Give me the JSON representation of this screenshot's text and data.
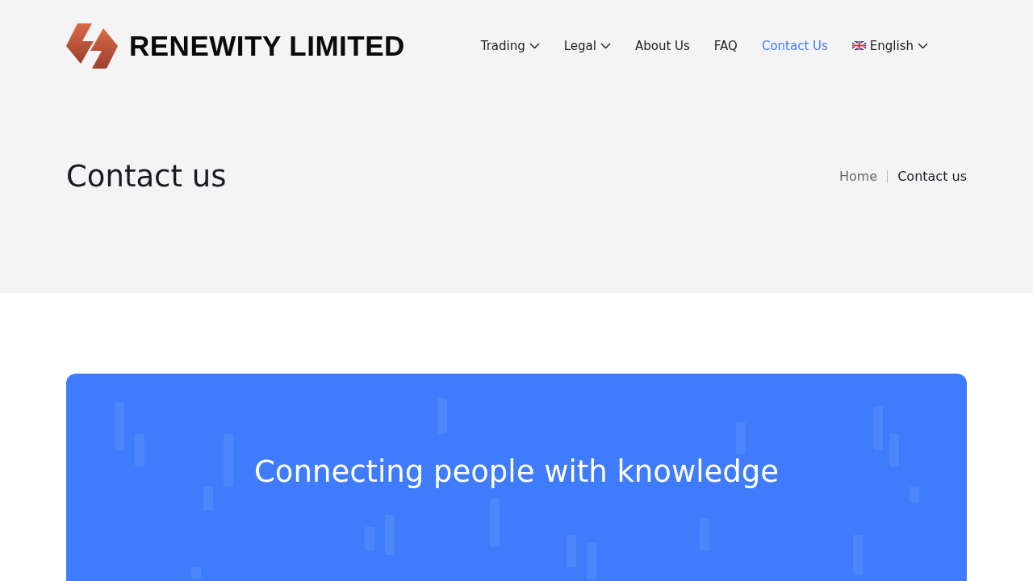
{
  "header": {
    "brand": "RENEWITY LIMITED",
    "nav": [
      {
        "label": "Trading",
        "kind": "dropdown",
        "selected": false
      },
      {
        "label": "Legal",
        "kind": "dropdown",
        "selected": false
      },
      {
        "label": "About Us",
        "kind": "link",
        "selected": false
      },
      {
        "label": "FAQ",
        "kind": "link",
        "selected": false
      },
      {
        "label": "Contact Us",
        "kind": "link",
        "selected": true
      },
      {
        "label": "English",
        "kind": "language",
        "selected": false
      }
    ]
  },
  "hero": {
    "title": "Contact us",
    "breadcrumb": [
      {
        "label": "Home",
        "selected": false
      },
      {
        "label": "Contact us",
        "selected": true
      }
    ]
  },
  "banner": {
    "heading": "Connecting people with knowledge"
  }
}
